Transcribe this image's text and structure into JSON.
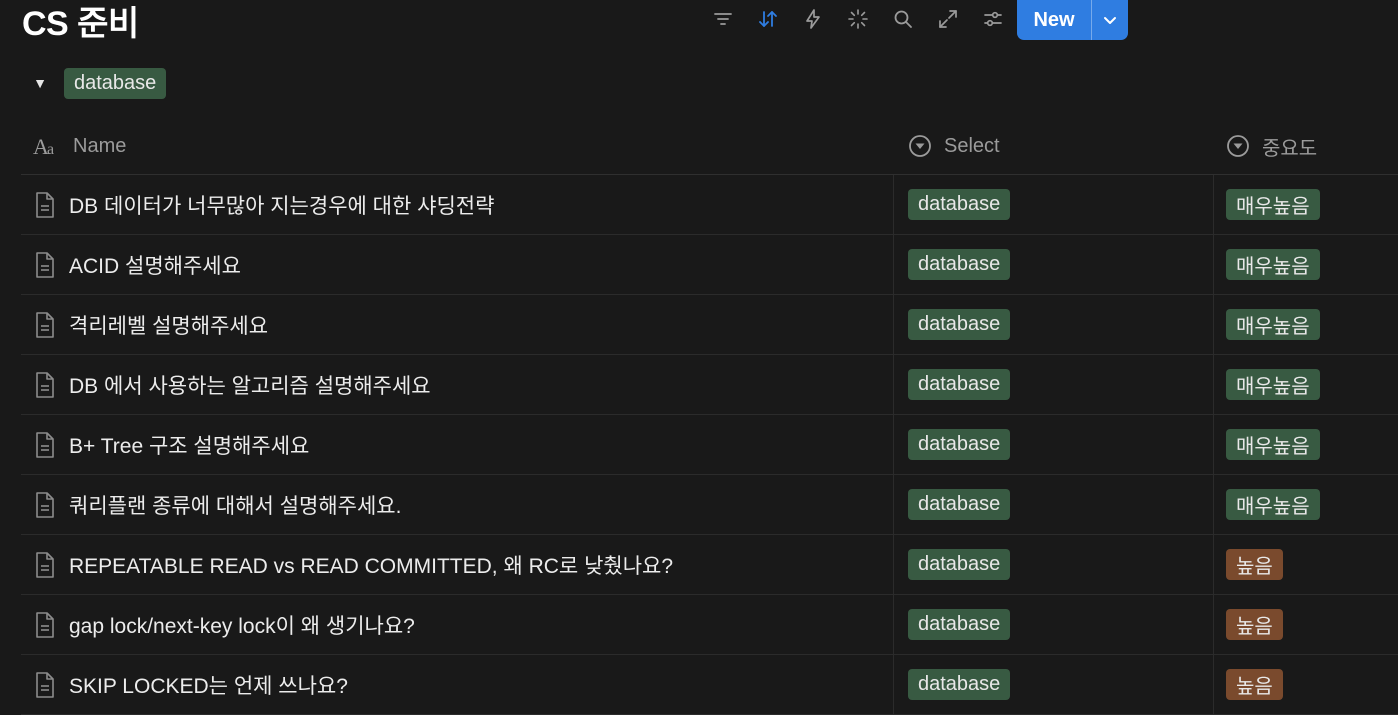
{
  "page": {
    "title": "CS 준비"
  },
  "toolbar": {
    "icons": [
      "filter-icon",
      "sort-icon",
      "automation-icon",
      "ai-icon",
      "search-icon",
      "expand-icon",
      "settings-icon"
    ],
    "new_label": "New",
    "accent_color": "#2f7de1"
  },
  "group": {
    "label": "database"
  },
  "table": {
    "columns": {
      "name": "Name",
      "select": "Select",
      "importance": "중요도"
    },
    "rows": [
      {
        "name": "DB 데이터가 너무많아 지는경우에 대한 샤딩전략",
        "select": "database",
        "importance": "매우높음",
        "importance_color": "#385a42"
      },
      {
        "name": "ACID 설명해주세요",
        "select": "database",
        "importance": "매우높음",
        "importance_color": "#385a42"
      },
      {
        "name": "격리레벨 설명해주세요",
        "select": "database",
        "importance": "매우높음",
        "importance_color": "#385a42"
      },
      {
        "name": "DB 에서 사용하는 알고리즘 설명해주세요",
        "select": "database",
        "importance": "매우높음",
        "importance_color": "#385a42"
      },
      {
        "name": "B+ Tree 구조 설명해주세요",
        "select": "database",
        "importance": "매우높음",
        "importance_color": "#385a42"
      },
      {
        "name": "쿼리플랜 종류에 대해서 설명해주세요.",
        "select": "database",
        "importance": "매우높음",
        "importance_color": "#385a42"
      },
      {
        "name": "REPEATABLE READ vs READ COMMITTED, 왜 RC로 낮췄나요?",
        "select": "database",
        "importance": "높음",
        "importance_color": "#7a4a2d"
      },
      {
        "name": "gap lock/next-key lock이 왜 생기나요?",
        "select": "database",
        "importance": "높음",
        "importance_color": "#7a4a2d"
      },
      {
        "name": "SKIP LOCKED는 언제 쓰나요?",
        "select": "database",
        "importance": "높음",
        "importance_color": "#7a4a2d"
      }
    ]
  }
}
